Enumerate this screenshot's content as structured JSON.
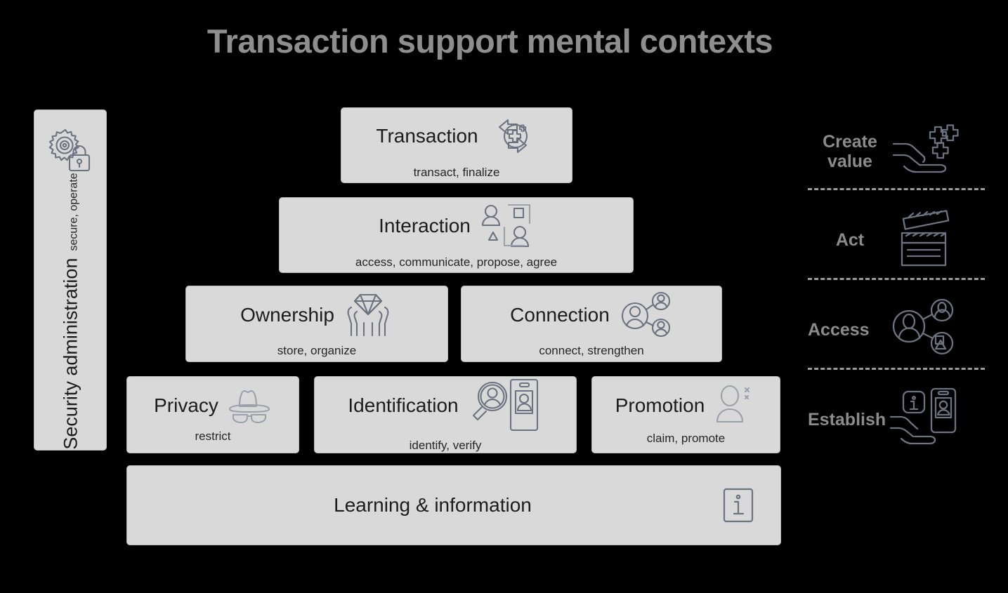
{
  "page": {
    "title": "Transaction support mental contexts",
    "background_color": "#000000",
    "card_fill": "#d9d9d9",
    "title_color": "#8e8e8e",
    "legend_label_color": "#8b8b8b",
    "icon_stroke_color": "#6b7280"
  },
  "sidebar": {
    "title": "Security administration",
    "subtitle": "secure, operate",
    "icon": "gear-lock-icon"
  },
  "pyramid": {
    "levels": [
      {
        "id": "transaction",
        "title": "Transaction",
        "subtitle": "transact, finalize",
        "icon": "transaction-arrows-plus-icon"
      },
      {
        "id": "interaction",
        "title": "Interaction",
        "subtitle": "access, communicate, propose, agree",
        "icon": "two-persons-shapes-icon"
      },
      {
        "id": "ownership",
        "title": "Ownership",
        "subtitle": "store, organize",
        "icon": "diamond-in-hands-icon"
      },
      {
        "id": "connection",
        "title": "Connection",
        "subtitle": "connect, strengthen",
        "icon": "person-network-icon"
      },
      {
        "id": "privacy",
        "title": "Privacy",
        "subtitle": "restrict",
        "icon": "incognito-hat-glasses-icon"
      },
      {
        "id": "identification",
        "title": "Identification",
        "subtitle": "identify, verify",
        "icon": "magnifier-person-id-badge-icon"
      },
      {
        "id": "promotion",
        "title": "Promotion",
        "subtitle": "claim, promote",
        "icon": "person-sparkle-icon"
      },
      {
        "id": "learning",
        "title": "Learning & information",
        "subtitle": "",
        "icon": "info-square-icon"
      }
    ]
  },
  "legend": {
    "items": [
      {
        "id": "create-value",
        "label": "Create value",
        "label_line1": "Create",
        "label_line2": "value",
        "icon": "hand-plus-signs-icon"
      },
      {
        "id": "act",
        "label": "Act",
        "icon": "clapperboard-icon"
      },
      {
        "id": "access",
        "label": "Access",
        "icon": "person-network-shapes-icon"
      },
      {
        "id": "establish",
        "label": "Establish",
        "icon": "hand-info-badge-icon"
      }
    ]
  }
}
